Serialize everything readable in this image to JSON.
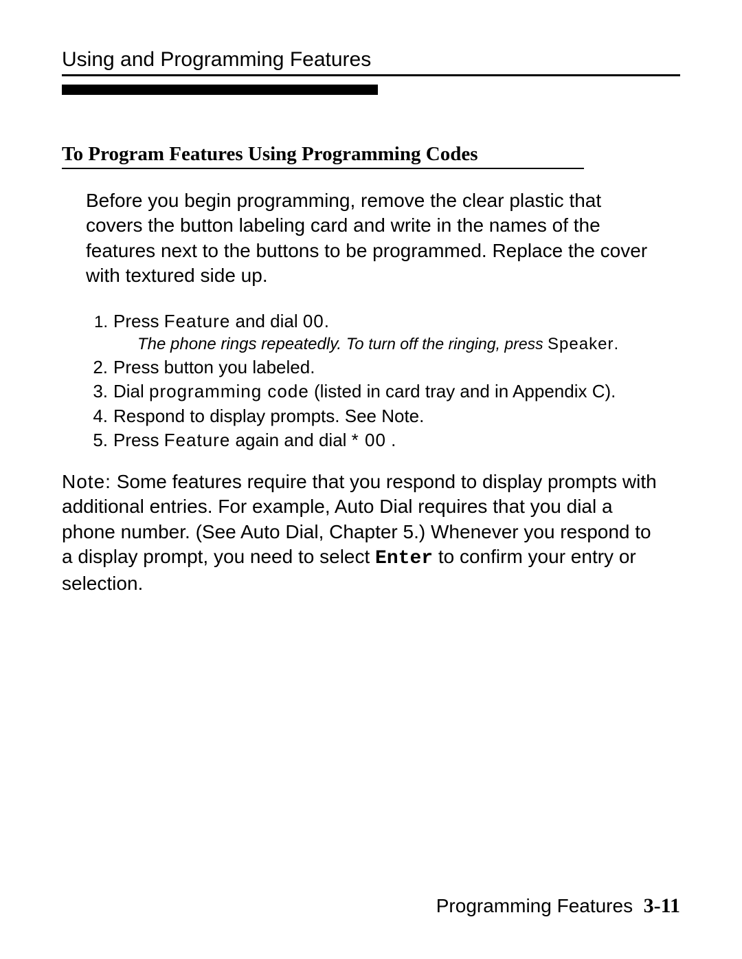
{
  "header": {
    "chapter_title": "Using and Programming Features"
  },
  "section": {
    "heading": "To Program Features Using Programming Codes",
    "intro": "Before you begin programming, remove the clear plastic that covers the button labeling card and write in the names of the features next to the buttons to be programmed. Replace the cover with textured side up."
  },
  "steps": [
    {
      "num": "1.",
      "pre": "Press ",
      "bold1": "Feature",
      "mid": " and dial ",
      "bold2": "00.",
      "note_pre": "The phone rings repeatedly. To ",
      "note_ital2": "turn off the ringing, press ",
      "note_bold": "Speaker",
      "note_post": "."
    },
    {
      "num": "2.",
      "text": "Press button you labeled."
    },
    {
      "num": "3.",
      "pre": "Dial ",
      "bold1": "programming code",
      "post": " (listed in card tray and in Appendix C)."
    },
    {
      "num": "4.",
      "text": "Respond to display prompts. See Note."
    },
    {
      "num": "5.",
      "pre": "Press ",
      "bold1": "Feature",
      "mid": " again and dial ",
      "bold2": "* 00",
      "post": " ."
    }
  ],
  "note": {
    "label": "Note:",
    "body_pre": " Some features require that you respond to display prompts with additional entries. For example, Auto Dial requires that you dial a phone number. (See Auto Dial, Chapter 5.) Whenever you respond to a display prompt, you need to select ",
    "code": "Enter",
    "body_post": " to confirm your entry or selection."
  },
  "footer": {
    "label": "Programming Features",
    "page": "3-11"
  }
}
